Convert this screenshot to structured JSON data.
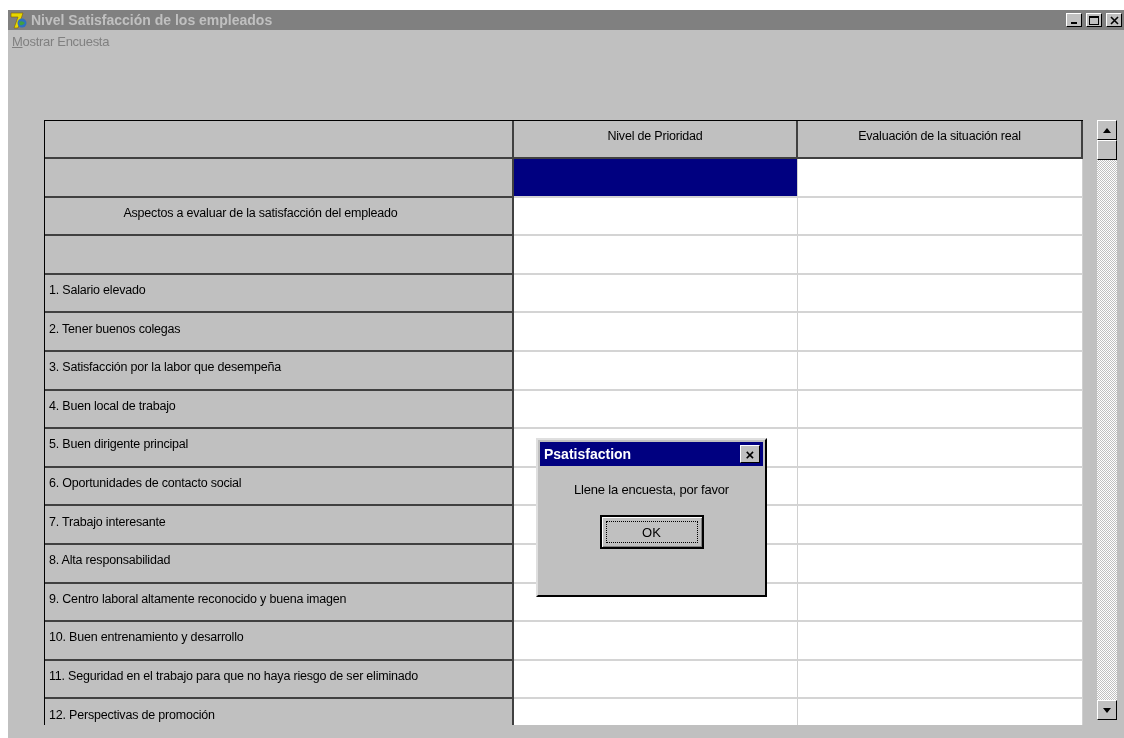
{
  "window": {
    "title": "Nivel Satisfacción de los empleados"
  },
  "menu": [
    {
      "label": "Mostrar Encuesta"
    }
  ],
  "table": {
    "columns": [
      "Nivel de Prioridad",
      "Evaluación de la situación real"
    ],
    "rows": [
      {
        "kind": "blank",
        "cells": [
          {
            "selected": true
          },
          {
            "selected": false
          }
        ]
      },
      {
        "kind": "heading",
        "label": "Aspectos a evaluar de la satisfacción del empleado",
        "cells": [
          {
            "selected": false
          },
          {
            "selected": false
          }
        ]
      },
      {
        "kind": "blank",
        "cells": [
          {
            "selected": false
          },
          {
            "selected": false
          }
        ]
      },
      {
        "kind": "item",
        "label": "1. Salario elevado",
        "cells": [
          {
            "selected": false
          },
          {
            "selected": false
          }
        ]
      },
      {
        "kind": "item",
        "label": "2. Tener buenos colegas",
        "cells": [
          {
            "selected": false
          },
          {
            "selected": false
          }
        ]
      },
      {
        "kind": "item",
        "label": "3. Satisfacción por la labor que desempeña",
        "cells": [
          {
            "selected": false
          },
          {
            "selected": false
          }
        ]
      },
      {
        "kind": "item",
        "label": "4. Buen local de trabajo",
        "cells": [
          {
            "selected": false
          },
          {
            "selected": false
          }
        ]
      },
      {
        "kind": "item",
        "label": "5. Buen dirigente principal",
        "cells": [
          {
            "selected": false
          },
          {
            "selected": false
          }
        ]
      },
      {
        "kind": "item",
        "label": "6. Oportunidades de contacto social",
        "cells": [
          {
            "selected": false
          },
          {
            "selected": false
          }
        ]
      },
      {
        "kind": "item",
        "label": "7. Trabajo interesante",
        "cells": [
          {
            "selected": false
          },
          {
            "selected": false
          }
        ]
      },
      {
        "kind": "item",
        "label": "8. Alta responsabilidad",
        "cells": [
          {
            "selected": false
          },
          {
            "selected": false
          }
        ]
      },
      {
        "kind": "item",
        "label": "9. Centro laboral altamente reconocido y buena imagen",
        "cells": [
          {
            "selected": false
          },
          {
            "selected": false
          }
        ]
      },
      {
        "kind": "item",
        "label": "10. Buen entrenamiento y desarrollo",
        "cells": [
          {
            "selected": false
          },
          {
            "selected": false
          }
        ]
      },
      {
        "kind": "item",
        "label": "11. Seguridad en el trabajo para que no haya riesgo de ser eliminado",
        "cells": [
          {
            "selected": false
          },
          {
            "selected": false
          }
        ]
      },
      {
        "kind": "item",
        "label": "12. Perspectivas de promoción",
        "cells": [
          {
            "selected": false
          },
          {
            "selected": false
          }
        ]
      }
    ]
  },
  "dialog": {
    "title": "Psatisfaction",
    "close": "×",
    "message": "Llene la encuesta, por favor",
    "button": "OK"
  }
}
